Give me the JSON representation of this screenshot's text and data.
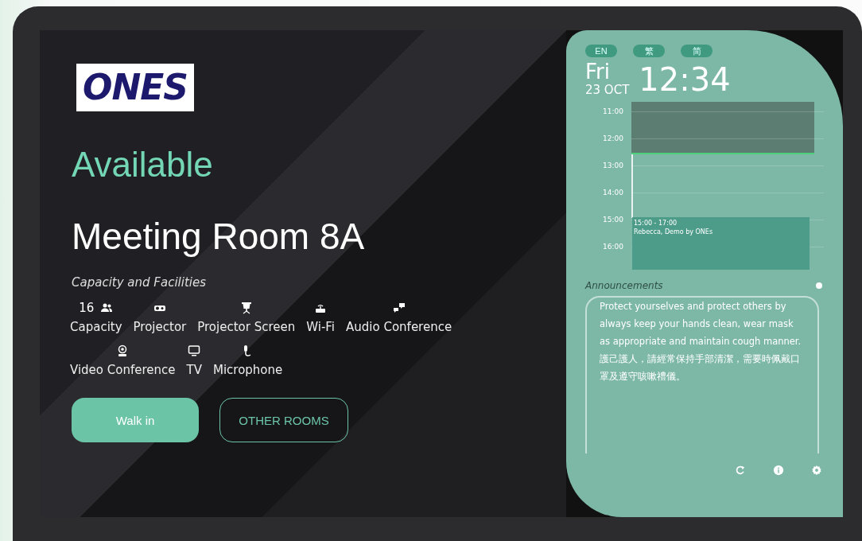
{
  "logo": "ONES",
  "status": "Available",
  "room": "Meeting Room 8A",
  "facilities_title": "Capacity and Facilities",
  "facilities": [
    {
      "kind": "capacity",
      "count": "16",
      "label": "Capacity"
    },
    {
      "kind": "projector",
      "label": "Projector"
    },
    {
      "kind": "screen",
      "label": "Projector Screen"
    },
    {
      "kind": "wifi",
      "label": "Wi-Fi"
    },
    {
      "kind": "audio",
      "label": "Audio Conference"
    },
    {
      "kind": "video",
      "label": "Video Conference"
    },
    {
      "kind": "tv",
      "label": "TV"
    },
    {
      "kind": "microphone",
      "label": "Microphone"
    }
  ],
  "buttons": [
    {
      "kind": "primary",
      "label": "Walk in"
    },
    {
      "kind": "outline",
      "label": "OTHER ROOMS"
    }
  ],
  "languages": [
    {
      "label": "EN"
    },
    {
      "label": "繁"
    },
    {
      "label": "简"
    }
  ],
  "date": {
    "day": "Fri",
    "date": "23 OCT",
    "time": "12:34"
  },
  "schedule": {
    "hours": [
      "11:00",
      "12:00",
      "13:00",
      "14:00",
      "15:00",
      "16:00"
    ],
    "events": [
      {
        "time": "15:00 - 17:00",
        "title": "Rebecca, Demo by ONEs"
      }
    ]
  },
  "announcements": {
    "title": "Announcements",
    "text": [
      "Protect yourselves and protect others by always keep your hands clean, wear mask as appropriate and maintain cough manner.",
      "護己護人，請經常保持手部清潔，需要時佩戴口罩及遵守咳嗽禮儀。"
    ]
  }
}
